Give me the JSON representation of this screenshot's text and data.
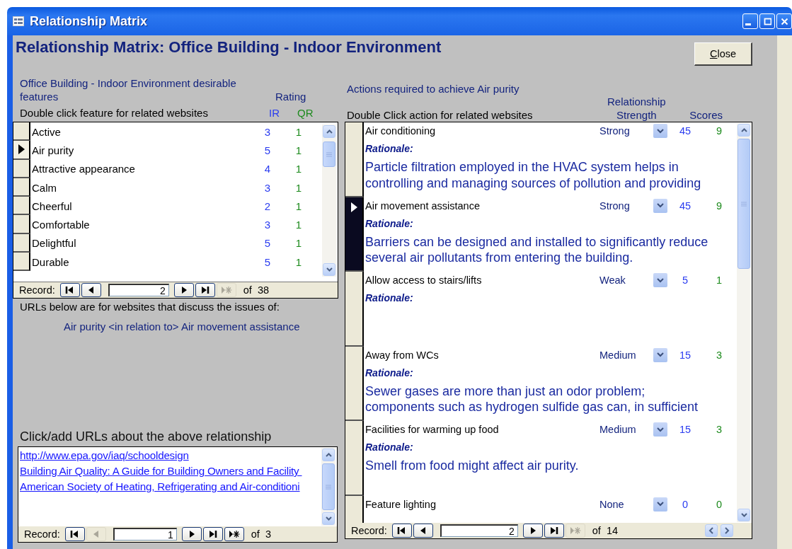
{
  "window": {
    "title": "Relationship Matrix"
  },
  "heading": "Relationship Matrix: Office Building - Indoor Environment",
  "close_button": "Close",
  "features_panel": {
    "title": "Office Building - Indoor Environment desirable features",
    "rating_header": "Rating",
    "hint": "Double click feature for related websites",
    "ir_header": "IR",
    "qr_header": "QR",
    "rows": [
      {
        "name": "Active",
        "ir": "3",
        "qr": "1",
        "selected": false
      },
      {
        "name": "Air purity",
        "ir": "5",
        "qr": "1",
        "selected": true
      },
      {
        "name": "Attractive appearance",
        "ir": "4",
        "qr": "1",
        "selected": false
      },
      {
        "name": "Calm",
        "ir": "3",
        "qr": "1",
        "selected": false
      },
      {
        "name": "Cheerful",
        "ir": "2",
        "qr": "1",
        "selected": false
      },
      {
        "name": "Comfortable",
        "ir": "3",
        "qr": "1",
        "selected": false
      },
      {
        "name": "Delightful",
        "ir": "5",
        "qr": "1",
        "selected": false
      },
      {
        "name": "Durable",
        "ir": "5",
        "qr": "1",
        "selected": false
      }
    ],
    "navigation": {
      "label": "Record:",
      "current": "2",
      "of": "of",
      "total": "38",
      "buttons": [
        {
          "kind": "first",
          "disabled": false
        },
        {
          "kind": "prev",
          "disabled": false
        },
        {
          "kind": "next",
          "disabled": false
        },
        {
          "kind": "last",
          "disabled": false
        },
        {
          "kind": "new",
          "disabled": true
        }
      ]
    }
  },
  "links_panel": {
    "intro": "URLs below are for websites that discuss the issues of:",
    "relation": "Air purity <in relation to> Air movement assistance",
    "add_label": "Click/add URLs about the above relationship",
    "links": [
      "http://www.epa.gov/iaq/schooldesign",
      "Building Air Quality: A Guide for Building Owners and Facility ",
      "American Society of Heating, Refrigerating and Air-conditioni"
    ],
    "navigation": {
      "label": "Record:",
      "current": "1",
      "of": "of",
      "total": "3",
      "buttons": [
        {
          "kind": "first",
          "disabled": false
        },
        {
          "kind": "prev",
          "disabled": true
        },
        {
          "kind": "next",
          "disabled": false
        },
        {
          "kind": "last",
          "disabled": false
        },
        {
          "kind": "new",
          "disabled": false
        }
      ]
    }
  },
  "actions_panel": {
    "title": "Actions required to achieve Air purity",
    "strength_header": "Relationship Strength",
    "scores_header": "Scores",
    "hint": "Double Click action for related websites",
    "rows": [
      {
        "name": "Air conditioning",
        "strength": "Strong",
        "ir_score": "45",
        "qr_score": "9",
        "rationale_label": "Rationale:",
        "rationale": "Particle filtration employed in the HVAC system helps in controlling and managing sources of pollution and providing",
        "selected": false
      },
      {
        "name": "Air movement assistance",
        "strength": "Strong",
        "ir_score": "45",
        "qr_score": "9",
        "rationale_label": "Rationale:",
        "rationale": "Barriers can be designed and installed to significantly reduce several air pollutants from entering the building.",
        "selected": true
      },
      {
        "name": "Allow access to stairs/lifts",
        "strength": "Weak",
        "ir_score": "5",
        "qr_score": "1",
        "rationale_label": "Rationale:",
        "selected": false
      },
      {
        "name": "Away from WCs",
        "strength": "Medium",
        "ir_score": "15",
        "qr_score": "3",
        "rationale_label": "Rationale:",
        "rationale": "Sewer gases are more than just an odor problem; components such as hydrogen sulfide gas can, in sufficient",
        "selected": false
      },
      {
        "name": "Facilities for warming up food",
        "strength": "Medium",
        "ir_score": "15",
        "qr_score": "3",
        "rationale_label": "Rationale:",
        "rationale": "Smell from food might affect air purity.",
        "selected": false
      },
      {
        "name": "Feature lighting",
        "strength": "None",
        "ir_score": "0",
        "qr_score": "0",
        "selected": false
      }
    ],
    "navigation": {
      "label": "Record:",
      "current": "2",
      "of": "of",
      "total": "14",
      "buttons": [
        {
          "kind": "first",
          "disabled": false
        },
        {
          "kind": "prev",
          "disabled": false
        },
        {
          "kind": "next",
          "disabled": false
        },
        {
          "kind": "last",
          "disabled": false
        },
        {
          "kind": "new",
          "disabled": true
        }
      ]
    }
  }
}
